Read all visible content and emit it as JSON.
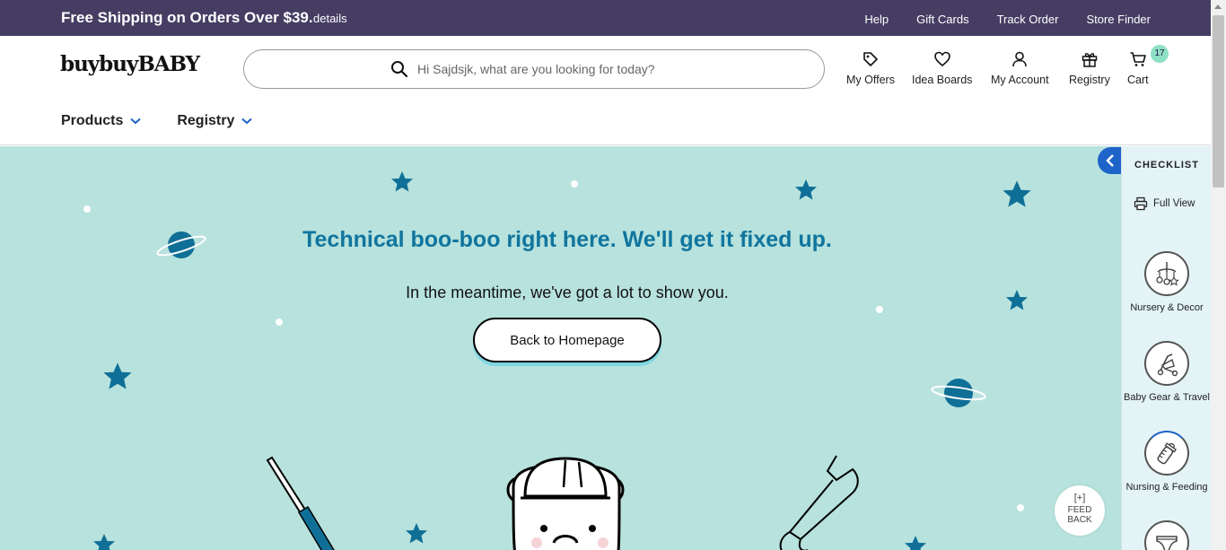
{
  "promo": {
    "main": "Free Shipping on Orders Over $39.",
    "details": "details",
    "links": [
      "Help",
      "Gift Cards",
      "Track Order",
      "Store Finder"
    ]
  },
  "header": {
    "logo": "buybuyBABY",
    "search_placeholder": "Hi Sajdsjk, what are you looking for today?",
    "actions": {
      "offers": "My Offers",
      "idea_boards": "Idea Boards",
      "account": "My Account",
      "registry": "Registry",
      "cart": "Cart",
      "cart_count": "17"
    },
    "nav": {
      "products": "Products",
      "registry": "Registry"
    }
  },
  "hero": {
    "title": "Technical boo-boo right here. We'll get it fixed up.",
    "subtitle": "In the meantime, we've got a lot to show you.",
    "button": "Back to Homepage"
  },
  "feedback": {
    "plus": "[+]",
    "line1": "FEED",
    "line2": "BACK"
  },
  "checklist": {
    "title": "CHECKLIST",
    "full_view": "Full View",
    "items": [
      {
        "label": "Nursery & Decor",
        "icon": "mobile-icon"
      },
      {
        "label": "Baby Gear & Travel",
        "icon": "stroller-icon"
      },
      {
        "label": "Nursing & Feeding",
        "icon": "bottle-icon"
      },
      {
        "label": "",
        "icon": "diaper-icon"
      }
    ]
  },
  "colors": {
    "promo_bg": "#463d63",
    "hero_bg": "#b7e2dd",
    "title_blue": "#10759e",
    "star_blue": "#0f6f97",
    "toggle_blue": "#1d63c9",
    "badge_green": "#8de0c4"
  }
}
